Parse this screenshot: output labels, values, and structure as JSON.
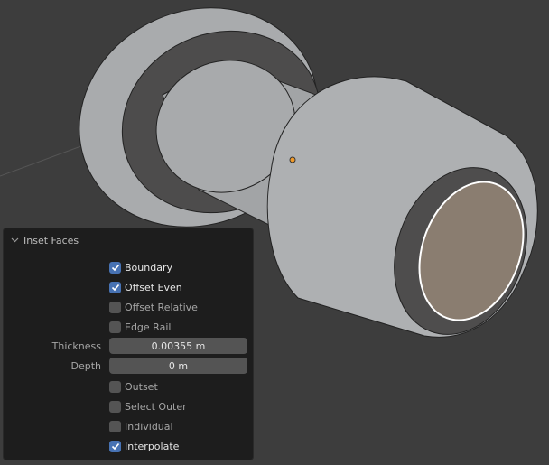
{
  "viewport": {
    "background": "#3d3d3d",
    "mesh_color": "#a8aaac",
    "inner_ring_color": "#4e4d4d",
    "selected_face_color": "#8a7d70",
    "selected_edge_color": "#ffffff",
    "origin_dot_color": "#f09a2a"
  },
  "panel": {
    "title": "Inset Faces",
    "options": [
      {
        "label": "Boundary",
        "checked": true
      },
      {
        "label": "Offset Even",
        "checked": true
      },
      {
        "label": "Offset Relative",
        "checked": false
      },
      {
        "label": "Edge Rail",
        "checked": false
      }
    ],
    "fields": [
      {
        "label": "Thickness",
        "value": "0.00355 m"
      },
      {
        "label": "Depth",
        "value": "0 m"
      }
    ],
    "options2": [
      {
        "label": "Outset",
        "checked": false
      },
      {
        "label": "Select Outer",
        "checked": false
      },
      {
        "label": "Individual",
        "checked": false
      },
      {
        "label": "Interpolate",
        "checked": true
      }
    ]
  }
}
